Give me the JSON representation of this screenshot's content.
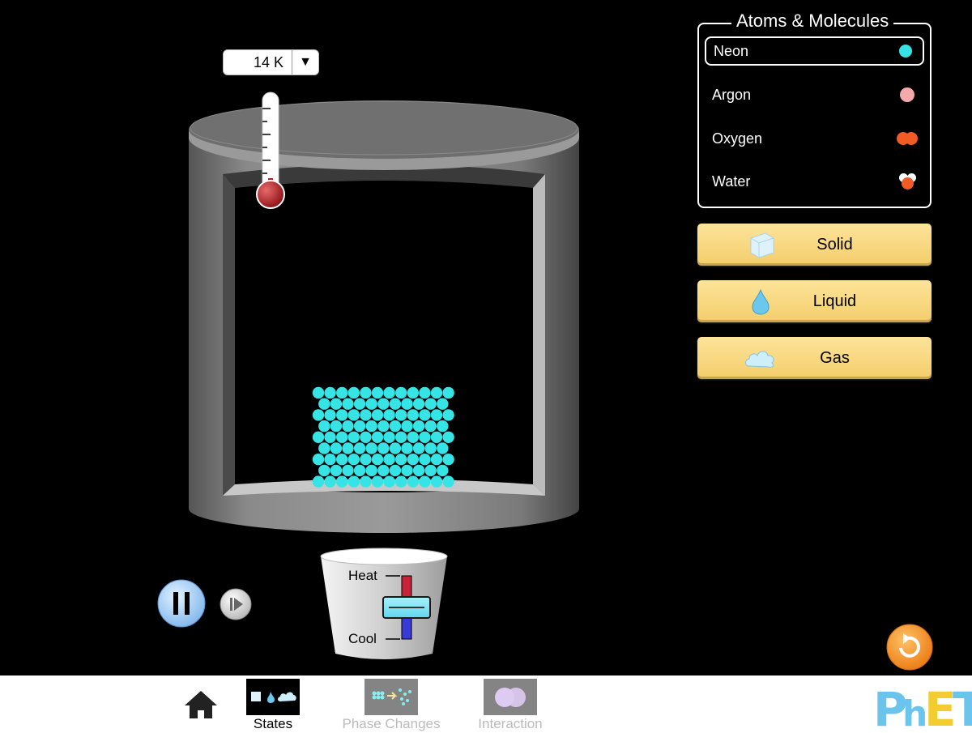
{
  "thermometer": {
    "temperature": "14 K",
    "dropdown_icon": "triangle-down-icon"
  },
  "atoms_panel": {
    "title": "Atoms & Molecules",
    "selected": "Neon",
    "items": [
      {
        "label": "Neon",
        "color": "#36e4e6"
      },
      {
        "label": "Argon",
        "color": "#f5a9a9"
      },
      {
        "label": "Oxygen",
        "color": "#f25b24"
      },
      {
        "label": "Water",
        "colors": [
          "#ffffff",
          "#f25b24"
        ]
      }
    ]
  },
  "phase_buttons": [
    {
      "label": "Solid",
      "icon": "ice-cube-icon"
    },
    {
      "label": "Liquid",
      "icon": "water-drop-icon"
    },
    {
      "label": "Gas",
      "icon": "cloud-icon"
    }
  ],
  "heater": {
    "heat_label": "Heat",
    "cool_label": "Cool",
    "level": 0
  },
  "particles": {
    "color": "#36e4e6",
    "rows": 9,
    "per_row": 12
  },
  "navbar": {
    "screens": [
      {
        "label": "States",
        "active": true
      },
      {
        "label": "Phase Changes",
        "active": false
      },
      {
        "label": "Interaction",
        "active": false
      }
    ],
    "logo_text": "PhET"
  },
  "colors": {
    "background": "#000000",
    "phase_button": "#f6d47a",
    "thermometer_bulb": "#b81e24",
    "reset_button": "#f5932a"
  }
}
